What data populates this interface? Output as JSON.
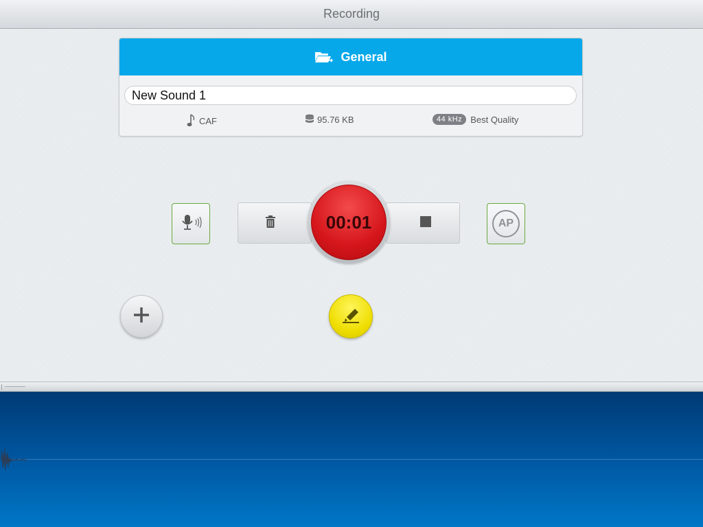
{
  "window": {
    "title": "Recording"
  },
  "folder": {
    "name": "General",
    "icon": "folder-arrow-icon"
  },
  "recording": {
    "name": "New Sound 1",
    "format": "CAF",
    "size": "95.76 KB",
    "sample_rate": "44 kHz",
    "quality": "Best Quality"
  },
  "controls": {
    "timer": "00:01",
    "ap_label": "AP",
    "mic_icon": "microphone-icon",
    "delete_icon": "trash-icon",
    "stop_icon": "stop-icon",
    "add_icon": "plus-icon",
    "edit_icon": "highlighter-icon"
  },
  "colors": {
    "header_blue": "#07a8ea",
    "record_red": "#d5161b",
    "edit_yellow": "#eedd00",
    "side_button_border": "#6aa83d",
    "waveform_bg": "#005aa5"
  }
}
